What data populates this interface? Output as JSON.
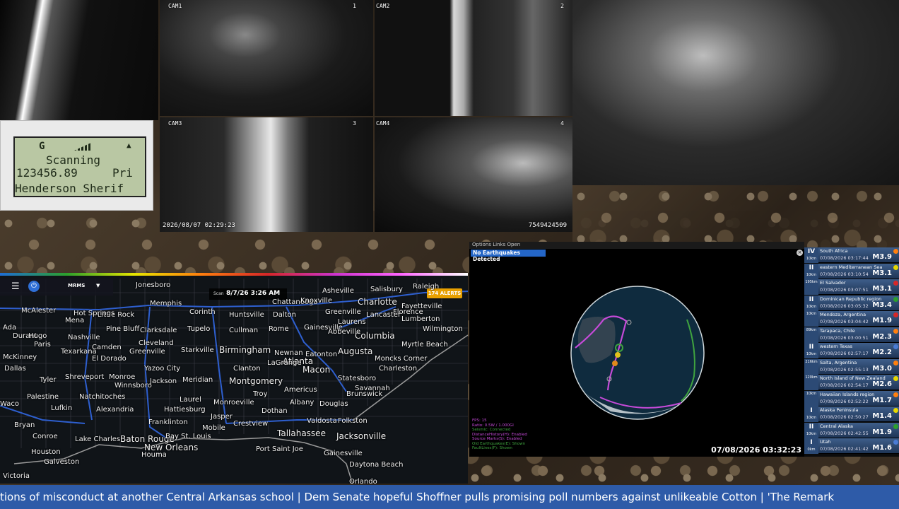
{
  "cameras": {
    "cam1_label": "CAM1",
    "cam1_num": "1",
    "cam2_label": "CAM2",
    "cam2_num": "2",
    "cam3_label": "CAM3",
    "cam3_num": "3",
    "cam4_label": "CAM4",
    "cam4_num": "4",
    "timestamp": "2026/08/07  02:29:23",
    "device_id": "7549424509"
  },
  "scanner": {
    "signal_char": "G",
    "status": "Scanning",
    "frequency": "123456.89",
    "priority": "Pri",
    "channel": "Henderson Sherif"
  },
  "weather": {
    "app_name": "MRMS",
    "scan_label": "Scan",
    "scan_time": "8/7/26 3:26 AM",
    "alerts_badge": "174 ALERTS",
    "cities": [
      {
        "name": "Jonesboro"
      },
      {
        "name": "McAlester"
      },
      {
        "name": "Little Rock"
      },
      {
        "name": "Memphis"
      },
      {
        "name": "Corinth"
      },
      {
        "name": "Huntsville"
      },
      {
        "name": "Chattanooga"
      },
      {
        "name": "Dalton"
      },
      {
        "name": "Knoxville"
      },
      {
        "name": "Asheville"
      },
      {
        "name": "Greenville"
      },
      {
        "name": "Charlotte"
      },
      {
        "name": "Salisbury"
      },
      {
        "name": "Raleigh"
      },
      {
        "name": "Fayetteville"
      },
      {
        "name": "Lumberton"
      },
      {
        "name": "Wilmington"
      },
      {
        "name": "Columbia"
      },
      {
        "name": "Myrtle Beach"
      },
      {
        "name": "Florence"
      },
      {
        "name": "Mena"
      },
      {
        "name": "Hot Springs"
      },
      {
        "name": "Pine Bluff"
      },
      {
        "name": "Clarksdale"
      },
      {
        "name": "Tupelo"
      },
      {
        "name": "Cullman"
      },
      {
        "name": "Rome"
      },
      {
        "name": "Gainesville"
      },
      {
        "name": "Abbeville"
      },
      {
        "name": "Laurens"
      },
      {
        "name": "Lancaster"
      },
      {
        "name": "Ada"
      },
      {
        "name": "Durant"
      },
      {
        "name": "Hugo"
      },
      {
        "name": "Nashville"
      },
      {
        "name": "Paris"
      },
      {
        "name": "Texarkana"
      },
      {
        "name": "Camden"
      },
      {
        "name": "El Dorado"
      },
      {
        "name": "Cleveland"
      },
      {
        "name": "Greenville"
      },
      {
        "name": "Starkville"
      },
      {
        "name": "Birmingham"
      },
      {
        "name": "Newnan"
      },
      {
        "name": "Atlanta"
      },
      {
        "name": "Eatonton"
      },
      {
        "name": "Augusta"
      },
      {
        "name": "Macon"
      },
      {
        "name": "Moncks Corner"
      },
      {
        "name": "Charleston"
      },
      {
        "name": "McKinney"
      },
      {
        "name": "Dallas"
      },
      {
        "name": "Tyler"
      },
      {
        "name": "Shreveport"
      },
      {
        "name": "Monroe"
      },
      {
        "name": "Winnsboro"
      },
      {
        "name": "Yazoo City"
      },
      {
        "name": "Jackson"
      },
      {
        "name": "Meridian"
      },
      {
        "name": "Clanton"
      },
      {
        "name": "Montgomery"
      },
      {
        "name": "LaGrange"
      },
      {
        "name": "Troy"
      },
      {
        "name": "Americus"
      },
      {
        "name": "Statesboro"
      },
      {
        "name": "Savannah"
      },
      {
        "name": "Palestine"
      },
      {
        "name": "Natchitoches"
      },
      {
        "name": "Laurel"
      },
      {
        "name": "Hattiesburg"
      },
      {
        "name": "Monroeville"
      },
      {
        "name": "Dothan"
      },
      {
        "name": "Albany"
      },
      {
        "name": "Douglas"
      },
      {
        "name": "Brunswick"
      },
      {
        "name": "Waco"
      },
      {
        "name": "Lufkin"
      },
      {
        "name": "Alexandria"
      },
      {
        "name": "Jasper"
      },
      {
        "name": "Franklinton"
      },
      {
        "name": "Valdosta"
      },
      {
        "name": "Folkston"
      },
      {
        "name": "Bryan"
      },
      {
        "name": "Conroe"
      },
      {
        "name": "Lake Charles"
      },
      {
        "name": "Baton Rouge"
      },
      {
        "name": "Bay St. Louis"
      },
      {
        "name": "Mobile"
      },
      {
        "name": "Crestview"
      },
      {
        "name": "Tallahassee"
      },
      {
        "name": "Jacksonville"
      },
      {
        "name": "New Orleans"
      },
      {
        "name": "Port Saint Joe"
      },
      {
        "name": "Houston"
      },
      {
        "name": "Houma"
      },
      {
        "name": "Gainesville"
      },
      {
        "name": "Daytona Beach"
      },
      {
        "name": "Galveston"
      },
      {
        "name": "Victoria"
      },
      {
        "name": "Orlando"
      }
    ]
  },
  "quakes": {
    "menu": "Options   Links   Open",
    "header": "No Earthquakes Detected",
    "clock": "07/08/2026 03:32:23",
    "status_lines": [
      "FPS: 15",
      "Ratio: 0.5W / 1.000Gl",
      "Seismic: Connected",
      "DistanceHistory(H): Enabled",
      "Source Marks(S): Enabled",
      "Old Earthquakes(E): Shown",
      "FaultLines(F): Shown"
    ],
    "list": [
      {
        "level": "IV",
        "depth": "10km",
        "location": "South Africa",
        "time": "07/08/2026 03:17:44",
        "mag": "M3.9",
        "color": "#ff7f0e"
      },
      {
        "level": "II",
        "depth": "10km",
        "location": "eastern Mediterranean Sea",
        "time": "07/08/2026 03:10:54",
        "mag": "M3.1",
        "color": "#e6d800"
      },
      {
        "level": "",
        "depth": "195km",
        "location": "El Salvador",
        "time": "07/08/2026 03:07:51",
        "mag": "M3.1",
        "color": "#d62728"
      },
      {
        "level": "II",
        "depth": "10km",
        "location": "Dominican Republic region",
        "time": "07/08/2026 03:05:32",
        "mag": "M3.4",
        "color": "#2ca02c"
      },
      {
        "level": "",
        "depth": "10km",
        "location": "Mendoza, Argentina",
        "time": "07/08/2026 03:04:42",
        "mag": "M1.9",
        "color": "#d62728"
      },
      {
        "level": "",
        "depth": "89km",
        "location": "Tarapaca, Chile",
        "time": "07/08/2026 03:00:51",
        "mag": "M2.3",
        "color": "#ff7f0e"
      },
      {
        "level": "II",
        "depth": "10km",
        "location": "western Texas",
        "time": "07/08/2026 02:57:17",
        "mag": "M2.2",
        "color": "#4a7bd4"
      },
      {
        "level": "",
        "depth": "216km",
        "location": "Salta, Argentina",
        "time": "07/08/2026 02:55:13",
        "mag": "M3.0",
        "color": "#ff7f0e"
      },
      {
        "level": "",
        "depth": "120km",
        "location": "North Island of New Zealand",
        "time": "07/08/2026 02:54:17",
        "mag": "M2.6",
        "color": "#e6d800"
      },
      {
        "level": "",
        "depth": "10km",
        "location": "Hawaiian Islands region",
        "time": "07/08/2026 02:52:22",
        "mag": "M1.7",
        "color": "#ff7f0e"
      },
      {
        "level": "I",
        "depth": "10km",
        "location": "Alaska Peninsula",
        "time": "07/08/2026 02:50:27",
        "mag": "M1.4",
        "color": "#e6d800"
      },
      {
        "level": "II",
        "depth": "10km",
        "location": "Central Alaska",
        "time": "07/08/2026 02:42:55",
        "mag": "M1.9",
        "color": "#2ca02c"
      },
      {
        "level": "I",
        "depth": "0km",
        "location": "Utah",
        "time": "07/08/2026 02:41:42",
        "mag": "M1.6",
        "color": "#4a7bd4"
      }
    ]
  },
  "ticker": {
    "text": "tions of misconduct at another Central Arkansas school   |   Dem Senate hopeful Shoffner pulls promising poll numbers against unlikeable Cotton   |   'The Remark"
  },
  "icons": {
    "menu": "menu-icon",
    "power": "power-icon",
    "dropdown": "chevron-down-icon",
    "close": "close-icon"
  }
}
